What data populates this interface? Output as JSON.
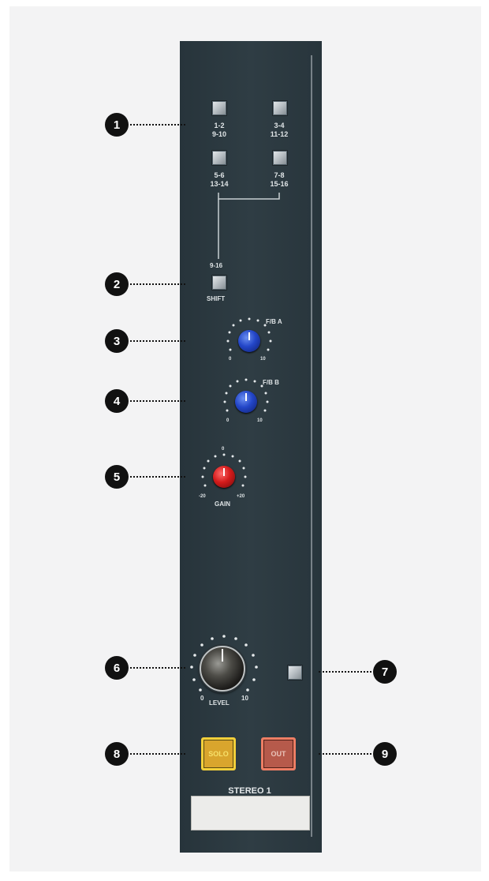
{
  "strip": {
    "group_buttons": [
      {
        "line1": "1-2",
        "line2": "9-10"
      },
      {
        "line1": "3-4",
        "line2": "11-12"
      },
      {
        "line1": "5-6",
        "line2": "13-14"
      },
      {
        "line1": "7-8",
        "line2": "15-16"
      }
    ],
    "shift": {
      "top_label": "9-16",
      "bottom_label": "SHIFT"
    },
    "fb_a": {
      "label": "F/B A",
      "min": "0",
      "max": "10"
    },
    "fb_b": {
      "label": "F/B B",
      "min": "0",
      "max": "10"
    },
    "gain": {
      "label": "GAIN",
      "top": "0",
      "min": "-20",
      "max": "+20"
    },
    "level": {
      "label": "LEVEL",
      "min": "0",
      "max": "10"
    },
    "solo_label": "SOLO",
    "out_label": "OUT",
    "channel_title": "STEREO 1"
  },
  "callouts": [
    "1",
    "2",
    "3",
    "4",
    "5",
    "6",
    "7",
    "8",
    "9"
  ],
  "colors": {
    "strip": "#2f3d44",
    "knob_blue": "#2346c8",
    "knob_red": "#d41b1b",
    "solo": "#f3cf3a",
    "out": "#ee7e64",
    "callout": "#111111"
  }
}
